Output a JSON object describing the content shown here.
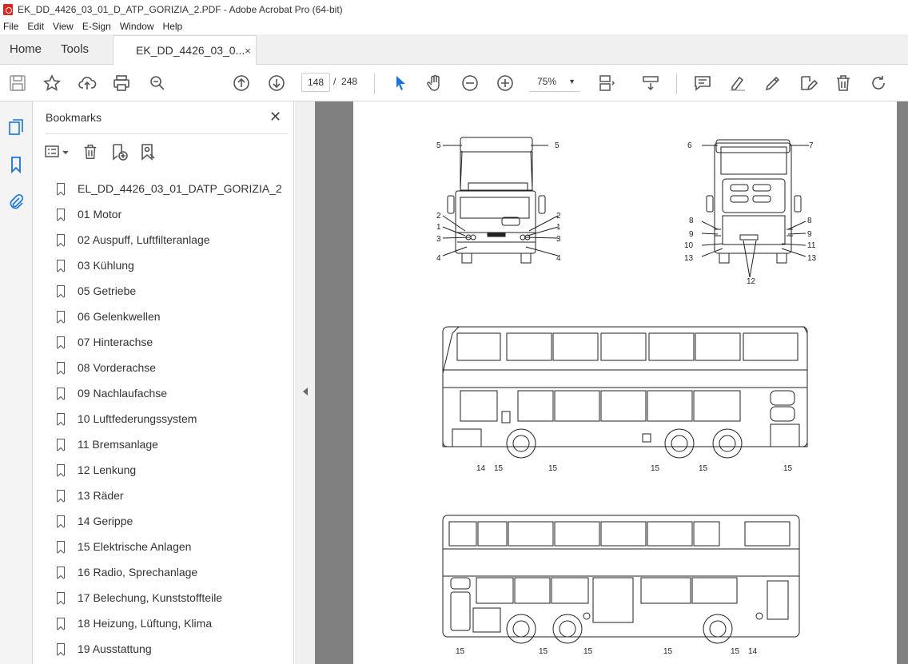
{
  "window": {
    "title": "EK_DD_4426_03_01_D_ATP_GORIZIA_2.PDF - Adobe Acrobat Pro (64-bit)"
  },
  "menu": [
    "File",
    "Edit",
    "View",
    "E-Sign",
    "Window",
    "Help"
  ],
  "tabs": {
    "home": "Home",
    "tools": "Tools",
    "document": "EK_DD_4426_03_0...",
    "close": "×"
  },
  "toolbar": {
    "current_page": "148",
    "page_separator": "/",
    "total_pages": "248",
    "zoom": "75%"
  },
  "bookmarks": {
    "header": "Bookmarks",
    "close": "✕",
    "items": [
      "EL_DD_4426_03_01_DATP_GORIZIA_2",
      "01 Motor",
      "02 Auspuff, Luftfilteranlage",
      "03 Kühlung",
      "05 Getriebe",
      "06 Gelenkwellen",
      "07 Hinterachse",
      "08 Vorderachse",
      "09 Nachlaufachse",
      "10 Luftfederungssystem",
      "11 Bremsanlage",
      "12 Lenkung",
      "13 Räder",
      "14 Gerippe",
      "15 Elektrische Anlagen",
      "16 Radio, Sprechanlage",
      "17 Belechung, Kunststoffteile",
      "18 Heizung, Lüftung, Klima",
      "19 Ausstattung"
    ]
  },
  "diagram": {
    "front_labels": {
      "l5a": "5",
      "l5b": "5",
      "l2a": "2",
      "l1a": "1",
      "l3a": "3",
      "l4a": "4",
      "l2b": "2",
      "l1b": "1",
      "l3b": "3",
      "l4b": "4"
    },
    "rear_labels": {
      "l6": "6",
      "l7": "7",
      "l8a": "8",
      "l9a": "9",
      "l10": "10",
      "l13a": "13",
      "l8b": "8",
      "l9b": "9",
      "l11": "11",
      "l13b": "13",
      "l12": "12"
    },
    "side1_labels": {
      "a": "14",
      "b": "15",
      "c": "15",
      "d": "15",
      "e": "15",
      "f": "15"
    },
    "side2_labels": {
      "a": "15",
      "b": "15",
      "c": "15",
      "d": "15",
      "e": "15",
      "f": "14"
    }
  },
  "colors": {
    "accent_blue": "#1473e6",
    "chrome": "#f0f0f0",
    "doc_bg": "#808080"
  }
}
